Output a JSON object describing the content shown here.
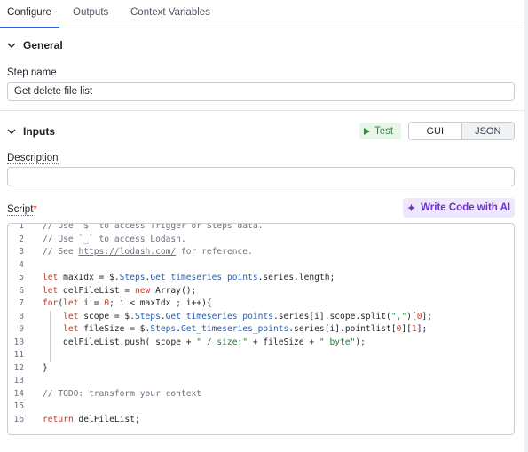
{
  "tabs": [
    {
      "label": "Configure",
      "active": true
    },
    {
      "label": "Outputs",
      "active": false
    },
    {
      "label": "Context Variables",
      "active": false
    }
  ],
  "general": {
    "title": "General",
    "step_name_label": "Step name",
    "step_name_value": "Get delete file list"
  },
  "inputs": {
    "title": "Inputs",
    "test_label": "Test",
    "mode_gui": "GUI",
    "mode_json": "JSON",
    "description_label": "Description",
    "description_value": "",
    "script_label": "Script",
    "required_mark": "*",
    "ai_button_label": "Write Code with AI"
  },
  "code_lines": [
    {
      "n": "1",
      "text": "// Use `$` to access Trigger or Steps data."
    },
    {
      "n": "2",
      "text": "// Use `_` to access Lodash."
    },
    {
      "n": "3",
      "text": "// See https://lodash.com/ for reference."
    },
    {
      "n": "4",
      "text": ""
    },
    {
      "n": "5",
      "text": "let maxIdx = $.Steps.Get_timeseries_points.series.length;"
    },
    {
      "n": "6",
      "text": "let delFileList = new Array();"
    },
    {
      "n": "7",
      "text": "for(let i = 0; i < maxIdx ; i++){"
    },
    {
      "n": "8",
      "text": "    let scope = $.Steps.Get_timeseries_points.series[i].scope.split(\",\")[0];"
    },
    {
      "n": "9",
      "text": "    let fileSize = $.Steps.Get_timeseries_points.series[i].pointlist[0][1];"
    },
    {
      "n": "10",
      "text": "    delFileList.push( scope + \" / size:\" + fileSize + \" byte\");"
    },
    {
      "n": "11",
      "text": ""
    },
    {
      "n": "12",
      "text": "}"
    },
    {
      "n": "13",
      "text": ""
    },
    {
      "n": "14",
      "text": "// TODO: transform your context"
    },
    {
      "n": "15",
      "text": ""
    },
    {
      "n": "16",
      "text": "return delFileList;"
    }
  ],
  "colors": {
    "accent": "#2f5fe0",
    "test_green": "#2e8b3c",
    "ai_purple": "#6b34c9",
    "required_red": "#d93025"
  },
  "icons": [
    "chevron-down-icon",
    "play-icon",
    "sparkle-icon"
  ]
}
